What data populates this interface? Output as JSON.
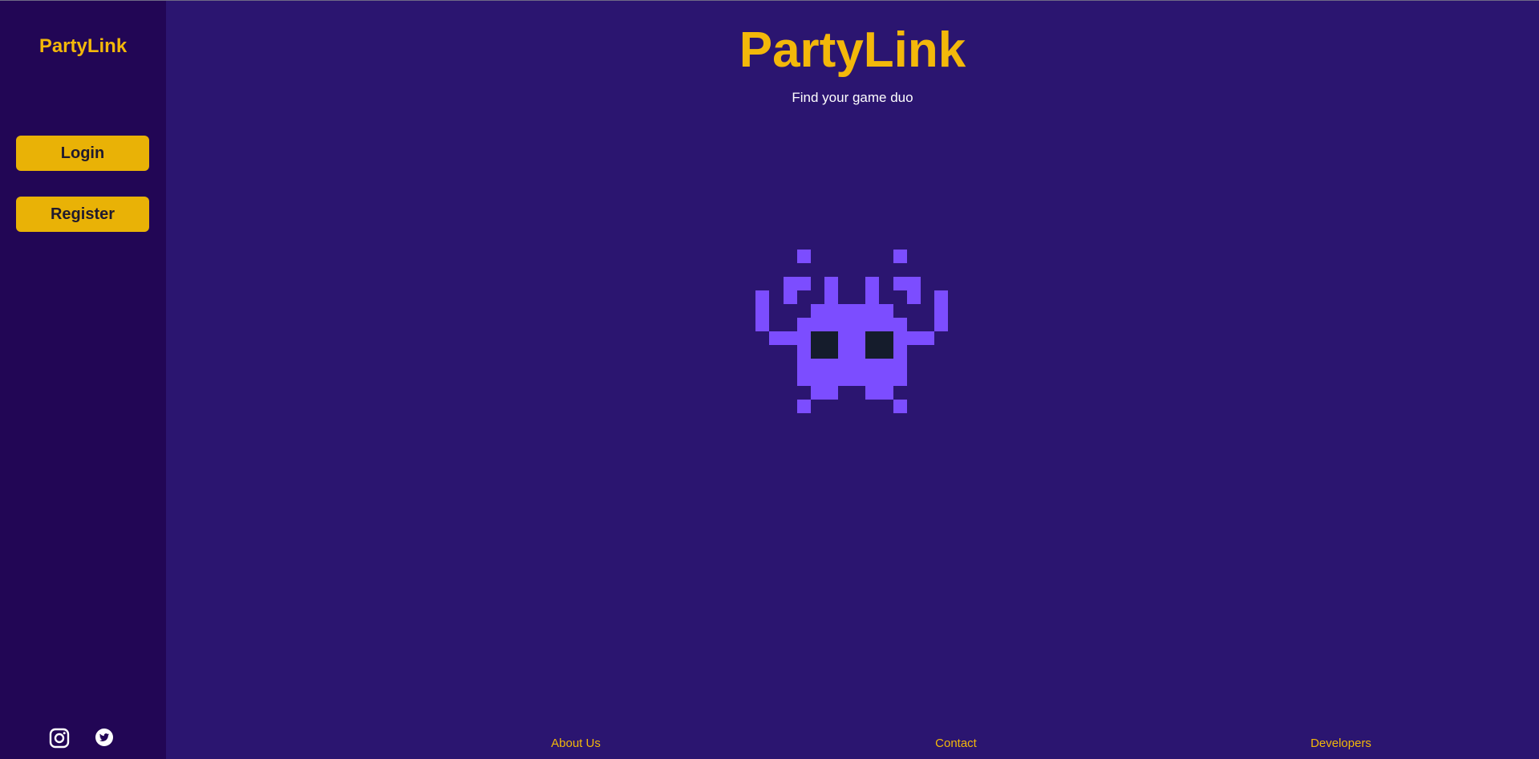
{
  "sidebar": {
    "brand": "PartyLink",
    "login_label": "Login",
    "register_label": "Register",
    "social": [
      {
        "icon": "instagram-icon"
      },
      {
        "icon": "twitter-icon"
      }
    ]
  },
  "main": {
    "title": "PartyLink",
    "subtitle": "Find your game duo",
    "mascot_icon": "pixel-alien-icon"
  },
  "footer": {
    "about_label": "About Us",
    "contact_label": "Contact",
    "developers_label": "Developers"
  },
  "colors": {
    "background": "#2b1570",
    "sidebar": "#220655",
    "accent": "#f3b80a",
    "button": "#e9b206",
    "mascot": "#7c4dff",
    "mascot_eyes": "#151c2c"
  }
}
